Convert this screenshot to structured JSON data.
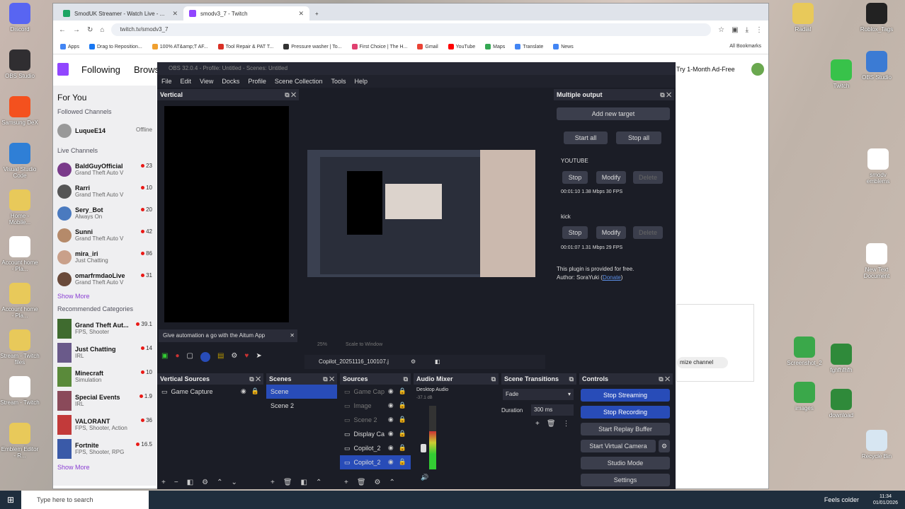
{
  "desktop": {
    "icons_left": [
      {
        "label": "Discord",
        "color": "#5865f2"
      },
      {
        "label": "OBS Studio",
        "color": "#302e31"
      },
      {
        "label": "Samsung DeX",
        "color": "#f4511e"
      },
      {
        "label": "Visual Studio Code",
        "color": "#2f7fd6"
      },
      {
        "label": "Home - Mobile...",
        "color": "#e8c95a"
      },
      {
        "label": "Account home - Pla...",
        "color": "#ffffff"
      },
      {
        "label": "Account home - Pla...",
        "color": "#e8c95a"
      },
      {
        "label": "Stream - Twitch files",
        "color": "#e8c95a"
      },
      {
        "label": "Stream - Twitch",
        "color": "#ffffff"
      },
      {
        "label": "Emblem Editor - R...",
        "color": "#e8c95a"
      }
    ],
    "icons_right": [
      {
        "label": "Radial",
        "color": "#e8c95a"
      },
      {
        "label": "Roblox_Tags",
        "color": "#222222"
      },
      {
        "label": "OBS Studio",
        "color": "#3b7bd4"
      },
      {
        "label": "Twitch",
        "color": "#38c24a"
      },
      {
        "label": "smodv emblems",
        "color": "#ffffff"
      },
      {
        "label": "New Text Document",
        "color": "#ffffff"
      },
      {
        "label": "Screenshot_2",
        "color": "#3aa84a"
      },
      {
        "label": "fghfhfhfh",
        "color": "#2f8a3a"
      },
      {
        "label": "images",
        "color": "#3aa84a"
      },
      {
        "label": "download",
        "color": "#2f8a3a"
      },
      {
        "label": "Recycle Bin",
        "color": "#d7e6f2"
      }
    ]
  },
  "browser": {
    "tabs": [
      {
        "label": "SmodUK Streamer - Watch Live - ...",
        "active": false,
        "favcolor": "#1da462"
      },
      {
        "label": "smodv3_7 - Twitch",
        "active": true,
        "favcolor": "#9146ff"
      }
    ],
    "new_tab": "+",
    "url": "twitch.tv/smodv3_7",
    "bookmarks": [
      {
        "label": "Apps",
        "color": "#4285f4"
      },
      {
        "label": "Drag to Reposition...",
        "color": "#1877f2"
      },
      {
        "label": "100% AT&amp;T AF...",
        "color": "#f0a030"
      },
      {
        "label": "Tool Repair & PAT T...",
        "color": "#d93025"
      },
      {
        "label": "Pressure washer | To...",
        "color": "#333333"
      },
      {
        "label": "First Choice | The H...",
        "color": "#e04070"
      },
      {
        "label": "Gmail",
        "color": "#ea4335"
      },
      {
        "label": "YouTube",
        "color": "#ff0000"
      },
      {
        "label": "Maps",
        "color": "#34a853"
      },
      {
        "label": "Translate",
        "color": "#4285f4"
      },
      {
        "label": "News",
        "color": "#4285f4"
      }
    ],
    "all_bookmarks": "All Bookmarks"
  },
  "twitch": {
    "nav_following": "Following",
    "nav_browse": "Brows",
    "ad_free": "Try 1-Month Ad-Free",
    "for_you": "For You",
    "followed_channels": "Followed Channels",
    "followed": [
      {
        "name": "LuqueE14",
        "status": "Offline"
      }
    ],
    "live_channels_label": "Live Channels",
    "live": [
      {
        "name": "BaldGuyOfficial",
        "game": "Grand Theft Auto V",
        "viewers": "23"
      },
      {
        "name": "Rarri",
        "game": "Grand Theft Auto V",
        "viewers": "10"
      },
      {
        "name": "Sery_Bot",
        "game": "Always On",
        "viewers": "20"
      },
      {
        "name": "Sunni",
        "game": "Grand Theft Auto V",
        "viewers": "42"
      },
      {
        "name": "mira_iri",
        "game": "Just Chatting",
        "viewers": "86"
      },
      {
        "name": "omarfrmdaoLive",
        "game": "Grand Theft Auto V",
        "viewers": "31"
      }
    ],
    "show_more": "Show More",
    "recommended_label": "Recommended Categories",
    "categories": [
      {
        "name": "Grand Theft Aut...",
        "tags": "FPS, Shooter",
        "viewers": "39.1"
      },
      {
        "name": "Just Chatting",
        "tags": "IRL",
        "viewers": "14"
      },
      {
        "name": "Minecraft",
        "tags": "Simulation",
        "viewers": "10"
      },
      {
        "name": "Special Events",
        "tags": "IRL",
        "viewers": "1.9"
      },
      {
        "name": "VALORANT",
        "tags": "FPS, Shooter, Action",
        "viewers": "36"
      },
      {
        "name": "Fortnite",
        "tags": "FPS, Shooter, RPG",
        "viewers": "16.5"
      }
    ],
    "show_more_2": "Show More",
    "customize_channel": "mize channel"
  },
  "obs": {
    "title": "OBS 32.0.4 - Profile: Untitled - Scenes: Untitled",
    "menu": [
      "File",
      "Edit",
      "View",
      "Docks",
      "Profile",
      "Scene Collection",
      "Tools",
      "Help"
    ],
    "vertical_dock": "Vertical",
    "vertical_notice": "Give automation a go with the Aitum App",
    "zoom": "25%",
    "scale": "Scale to Window",
    "source_name": "Copilot_20251116_100107.j",
    "multiple_output": {
      "title": "Multiple output",
      "add_target": "Add new target",
      "start_all": "Start all",
      "stop_all": "Stop all",
      "targets": [
        {
          "name": "YOUTUBE",
          "stop": "Stop",
          "modify": "Modify",
          "delete": "Delete",
          "stats": "00:01:10  1.38 Mbps  30 FPS"
        },
        {
          "name": "kick",
          "stop": "Stop",
          "modify": "Modify",
          "delete": "Delete",
          "stats": "00:01:07  1.31 Mbps  29 FPS"
        }
      ],
      "plugin_note": "This plugin is provided for free.",
      "author": "Author: SoraYuki",
      "donate": "Donate"
    },
    "vertical_sources": {
      "title": "Vertical Sources",
      "items": [
        "Game Capture"
      ]
    },
    "scenes": {
      "title": "Scenes",
      "items": [
        "Scene",
        "Scene 2"
      ],
      "selected": 0
    },
    "sources": {
      "title": "Sources",
      "items": [
        {
          "label": "Game Cap",
          "dim": true
        },
        {
          "label": "Image",
          "dim": true
        },
        {
          "label": "Scene 2",
          "dim": true
        },
        {
          "label": "Display Ca",
          "dim": false
        },
        {
          "label": "Copilot_2",
          "dim": false
        },
        {
          "label": "Copilot_2",
          "dim": false,
          "sel": true
        }
      ]
    },
    "audio_mixer": {
      "title": "Audio Mixer",
      "channel": "Desktop Audio",
      "level": "-37.1 dB",
      "meter_fraction": 0.6
    },
    "transitions": {
      "title": "Scene Transitions",
      "type": "Fade",
      "duration_label": "Duration",
      "duration": "300 ms"
    },
    "controls": {
      "title": "Controls",
      "stop_streaming": "Stop Streaming",
      "stop_recording": "Stop Recording",
      "replay_buffer": "Start Replay Buffer",
      "virtual_camera": "Start Virtual Camera",
      "studio_mode": "Studio Mode",
      "settings": "Settings"
    }
  },
  "taskbar": {
    "search": "Type here to search",
    "weather": "Feels colder",
    "time": "11:34",
    "date": "01/01/2026"
  }
}
